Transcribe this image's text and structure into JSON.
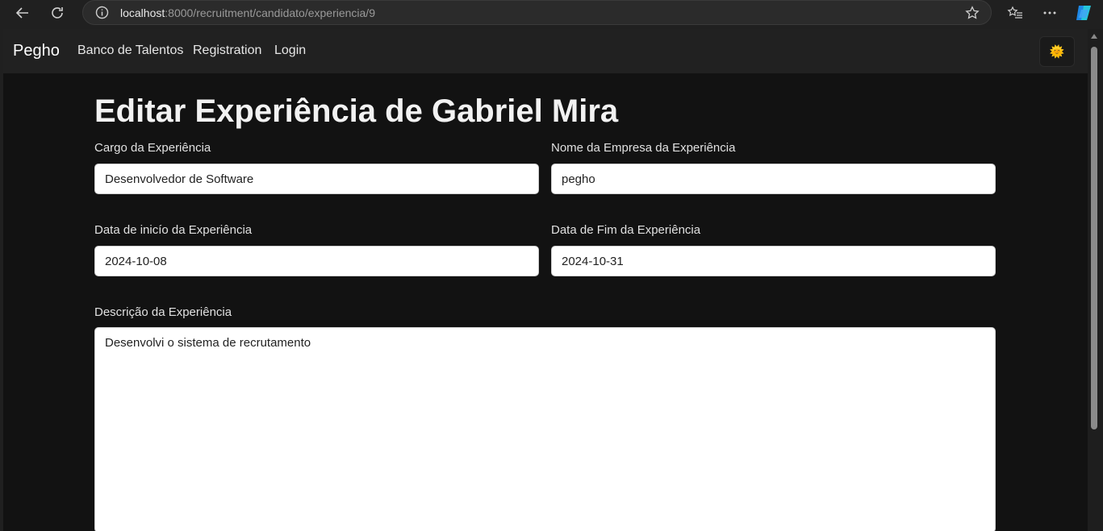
{
  "browser": {
    "url_host": "localhost",
    "url_path": ":8000/recruitment/candidato/experiencia/9"
  },
  "navbar": {
    "brand": "Pegho",
    "links": [
      "Banco de Talentos",
      "Registration",
      "Login"
    ],
    "theme_toggle_icon": "🌞"
  },
  "page": {
    "title": "Editar Experiência de Gabriel Mira"
  },
  "form": {
    "cargo_label": "Cargo da Experiência",
    "cargo_value": "Desenvolvedor de Software",
    "empresa_label": "Nome da Empresa da Experiência",
    "empresa_value": "pegho",
    "inicio_label": "Data de inicío da Experiência",
    "inicio_value": "2024-10-08",
    "fim_label": "Data de Fim da Experiência",
    "fim_value": "2024-10-31",
    "descricao_label": "Descrição da Experiência",
    "descricao_value": "Desenvolvi o sistema de recrutamento"
  },
  "colors": {
    "page_bg": "#121212",
    "navbar_bg": "#212121",
    "input_bg": "#ffffff"
  }
}
